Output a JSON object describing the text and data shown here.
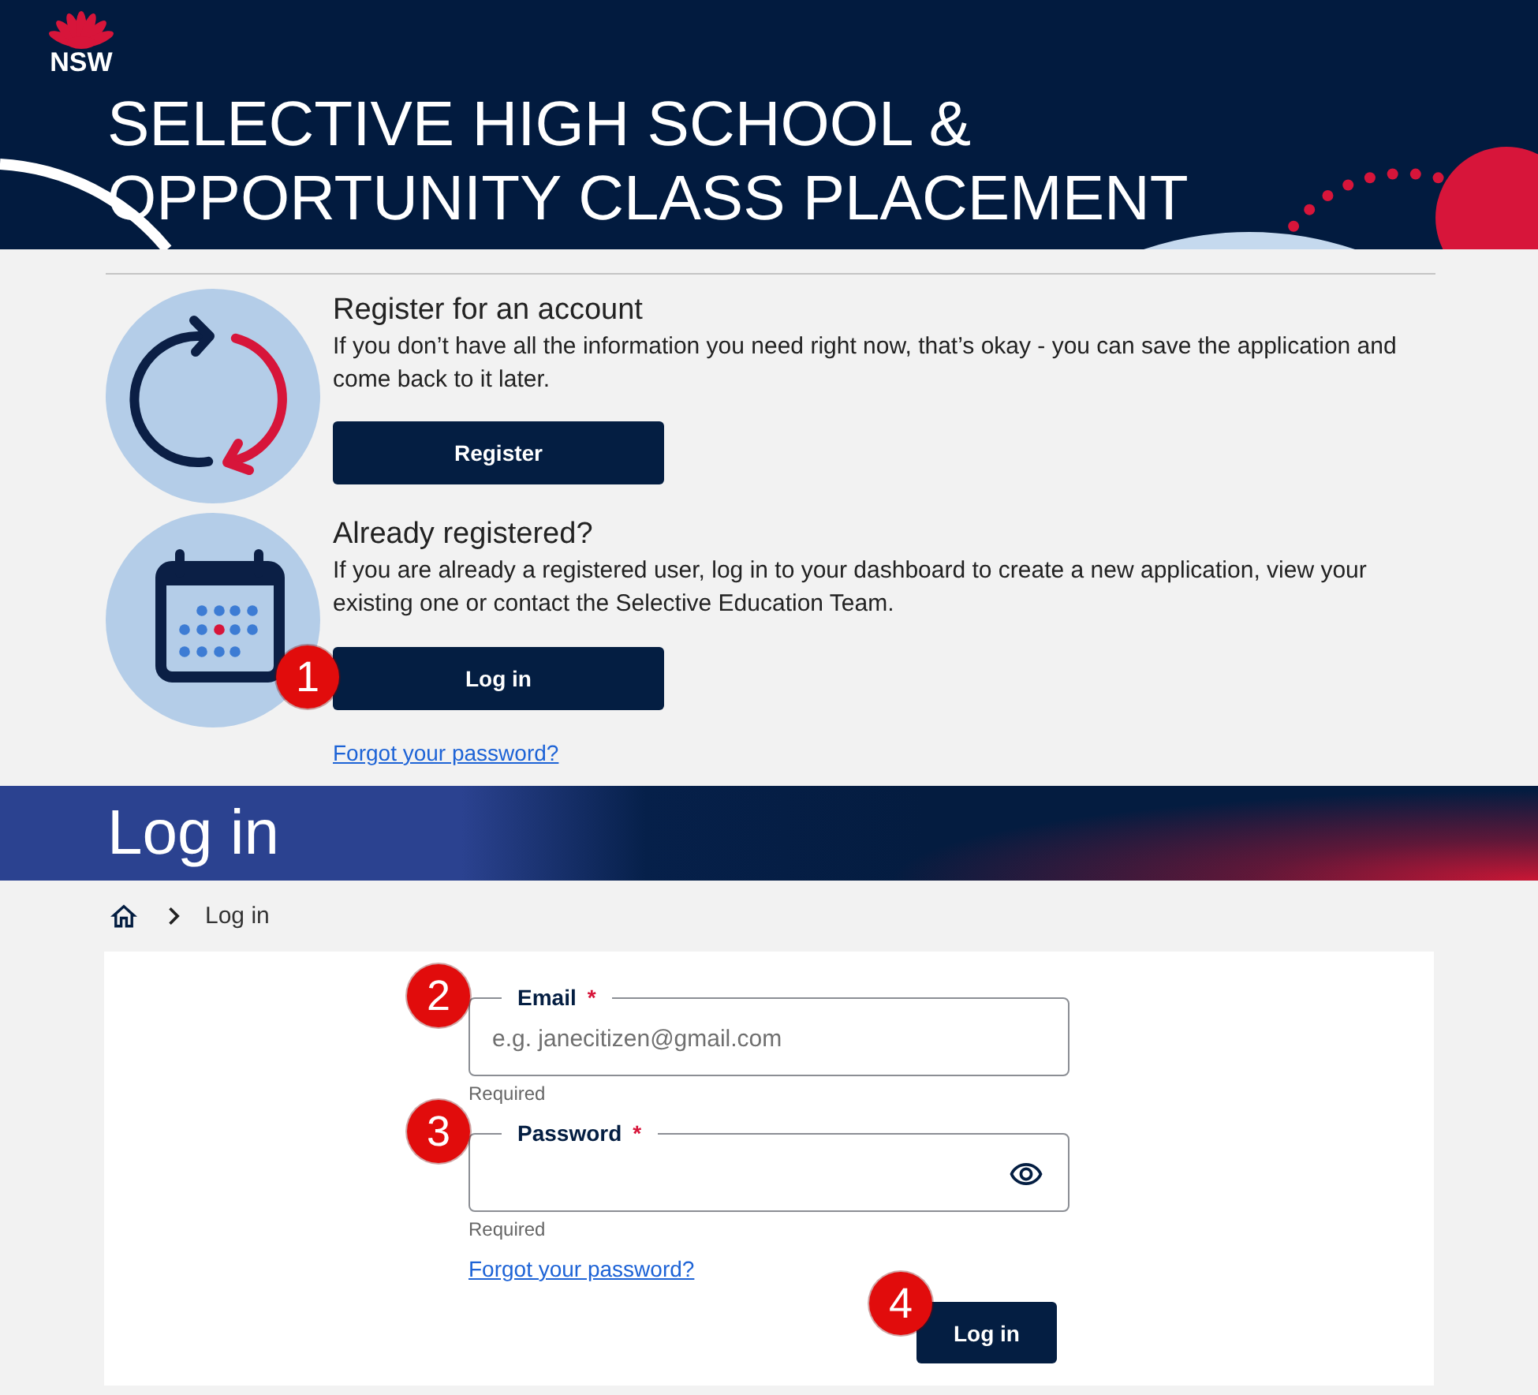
{
  "header": {
    "logo_text": "NSW",
    "title": "SELECTIVE HIGH SCHOOL & OPPORTUNITY CLASS PLACEMENT"
  },
  "options": [
    {
      "kind": "register",
      "heading": "Register for an account",
      "text": "If you don’t have all the information you need right now, that’s okay - you can save the application and come back to it later.",
      "button": "Register"
    },
    {
      "kind": "login",
      "heading": "Already registered?",
      "text": "If you are already a registered user, log in to your dashboard to create a new application, view your existing one or contact the Selective Education Team.",
      "button": "Log in",
      "callout": "1",
      "link": "Forgot your password?"
    }
  ],
  "banner": {
    "title": "Log in"
  },
  "breadcrumb": {
    "current": "Log in"
  },
  "form": {
    "fields": [
      {
        "kind": "email",
        "label": "Email",
        "required_mark": "*",
        "placeholder": "e.g. janecitizen@gmail.com",
        "hint": "Required",
        "callout": "2"
      },
      {
        "kind": "password",
        "label": "Password",
        "required_mark": "*",
        "hint": "Required",
        "callout": "3"
      }
    ],
    "link": "Forgot your password?",
    "button": "Log in",
    "button_callout": "4"
  }
}
